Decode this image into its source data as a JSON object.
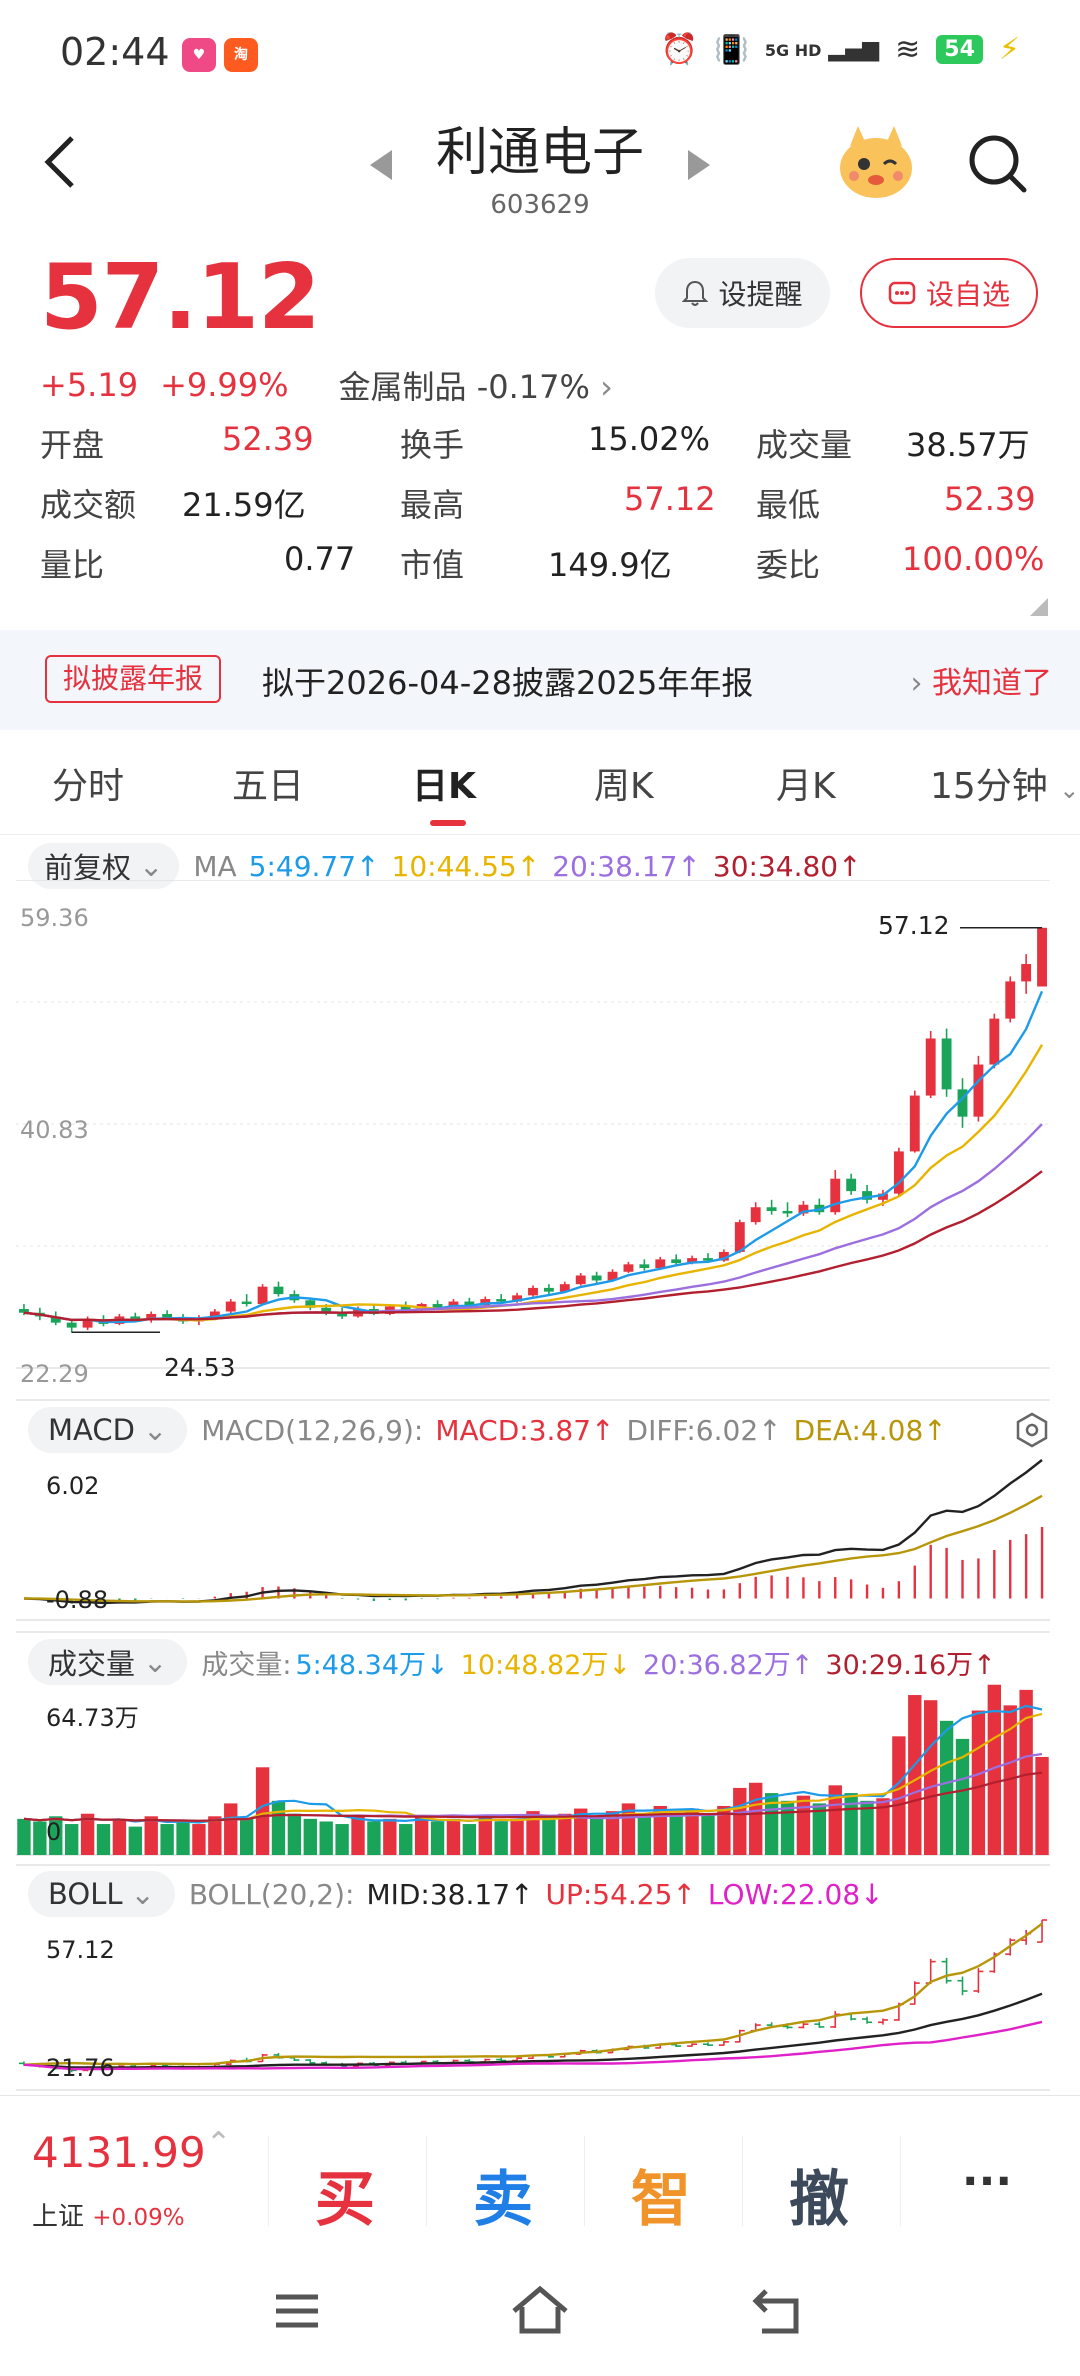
{
  "status_bar": {
    "time": "02:44",
    "network": "5G HD",
    "battery": "54"
  },
  "header": {
    "name": "利通电子",
    "code": "603629"
  },
  "quote": {
    "price": "57.12",
    "change": "+5.19",
    "change_pct": "+9.99%",
    "sector": "金属制品 -0.17%",
    "alert_label": "设提醒",
    "watch_label": "设自选"
  },
  "stats": [
    [
      {
        "label": "开盘",
        "value": "52.39",
        "color": "red"
      },
      {
        "label": "换手",
        "value": "15.02%",
        "color": "dark"
      },
      {
        "label": "成交量",
        "value": "38.57万",
        "color": "dark"
      }
    ],
    [
      {
        "label": "成交额",
        "value": "21.59亿",
        "color": "dark"
      },
      {
        "label": "最高",
        "value": "57.12",
        "color": "red"
      },
      {
        "label": "最低",
        "value": "52.39",
        "color": "red"
      }
    ],
    [
      {
        "label": "量比",
        "value": "0.77",
        "color": "dark"
      },
      {
        "label": "市值",
        "value": "149.9亿",
        "color": "dark"
      },
      {
        "label": "委比",
        "value": "100.00%",
        "color": "red"
      }
    ]
  ],
  "notice": {
    "tag": "拟披露年报",
    "text": "拟于2026-04-28披露2025年年报",
    "action": "我知道了"
  },
  "tabs": [
    "分时",
    "五日",
    "日K",
    "周K",
    "月K",
    "15分钟"
  ],
  "active_tab": 2,
  "ma_row": {
    "select": "前复权",
    "label": "MA",
    "items": [
      {
        "text": "5:49.77↑",
        "color": "#1e9be8"
      },
      {
        "text": "10:44.55↑",
        "color": "#e8b400"
      },
      {
        "text": "20:38.17↑",
        "color": "#9c6fe0"
      },
      {
        "text": "30:34.80↑",
        "color": "#b21f2f"
      }
    ]
  },
  "macd_row": {
    "select": "MACD",
    "label": "MACD(12,26,9):",
    "items": [
      {
        "text": "MACD:3.87↑",
        "color": "#e5323e"
      },
      {
        "text": "DIFF:6.02↑",
        "color": "#666666"
      },
      {
        "text": "DEA:4.08↑",
        "color": "#b8960a"
      }
    ]
  },
  "vol_row": {
    "select": "成交量",
    "label": "成交量:",
    "items": [
      {
        "text": "5:48.34万↓",
        "color": "#1e9be8"
      },
      {
        "text": "10:48.82万↓",
        "color": "#e8b400"
      },
      {
        "text": "20:36.82万↑",
        "color": "#9c6fe0"
      },
      {
        "text": "30:29.16万↑",
        "color": "#b21f2f"
      }
    ]
  },
  "boll_row": {
    "select": "BOLL",
    "label": "BOLL(20,2):",
    "items": [
      {
        "text": "MID:38.17↑",
        "color": "#222222"
      },
      {
        "text": "UP:54.25↑",
        "color": "#e5323e"
      },
      {
        "text": "LOW:22.08↓",
        "color": "#e020c8"
      }
    ]
  },
  "chart_data": {
    "type": "candlestick",
    "price_axis": {
      "top": "59.36",
      "mid": "40.83",
      "bottom": "22.29",
      "ylim": [
        22.29,
        59.36
      ]
    },
    "high_marker": "57.12",
    "low_marker": "24.53",
    "macd_axis": {
      "top": "6.02",
      "bottom": "-0.88",
      "ylim": [
        -0.88,
        6.02
      ]
    },
    "volume_axis": {
      "top": "64.73万",
      "bottom": "0",
      "ylim": [
        0,
        64.73
      ]
    },
    "boll_axis": {
      "top": "57.12",
      "bottom": "21.76",
      "ylim": [
        21.76,
        57.12
      ]
    },
    "colors": {
      "up": "#e5323e",
      "down": "#1aa45a",
      "ma5": "#1e9be8",
      "ma10": "#e8b400",
      "ma20": "#9c6fe0",
      "ma30": "#b21f2f"
    },
    "candles": [
      [
        26.4,
        26.8,
        25.9,
        26.1
      ],
      [
        26.1,
        26.5,
        25.5,
        25.8
      ],
      [
        25.8,
        26.2,
        25.1,
        25.3
      ],
      [
        25.3,
        25.6,
        24.5,
        24.9
      ],
      [
        24.9,
        25.8,
        24.7,
        25.6
      ],
      [
        25.6,
        25.9,
        25.0,
        25.2
      ],
      [
        25.2,
        26.0,
        25.1,
        25.8
      ],
      [
        25.8,
        26.1,
        25.4,
        25.5
      ],
      [
        25.5,
        26.2,
        25.3,
        26.0
      ],
      [
        26.0,
        26.3,
        25.6,
        25.7
      ],
      [
        25.7,
        26.0,
        25.2,
        25.4
      ],
      [
        25.4,
        25.9,
        25.1,
        25.6
      ],
      [
        25.6,
        26.4,
        25.5,
        26.2
      ],
      [
        26.2,
        27.2,
        26.0,
        27.0
      ],
      [
        27.0,
        27.6,
        26.6,
        26.8
      ],
      [
        26.8,
        28.4,
        26.7,
        28.2
      ],
      [
        28.2,
        28.6,
        27.4,
        27.6
      ],
      [
        27.6,
        27.9,
        26.9,
        27.1
      ],
      [
        27.1,
        27.3,
        26.3,
        26.5
      ],
      [
        26.5,
        26.8,
        25.9,
        26.1
      ],
      [
        26.1,
        26.5,
        25.6,
        25.8
      ],
      [
        25.8,
        26.6,
        25.7,
        26.4
      ],
      [
        26.4,
        26.7,
        25.9,
        26.0
      ],
      [
        26.0,
        26.8,
        25.9,
        26.6
      ],
      [
        26.6,
        27.0,
        26.2,
        26.3
      ],
      [
        26.3,
        26.9,
        26.1,
        26.8
      ],
      [
        26.8,
        27.1,
        26.4,
        26.5
      ],
      [
        26.5,
        27.2,
        26.4,
        27.0
      ],
      [
        27.0,
        27.3,
        26.6,
        26.7
      ],
      [
        26.7,
        27.4,
        26.6,
        27.2
      ],
      [
        27.2,
        27.6,
        26.9,
        27.0
      ],
      [
        27.0,
        27.7,
        26.9,
        27.5
      ],
      [
        27.5,
        28.3,
        27.4,
        28.1
      ],
      [
        28.1,
        28.4,
        27.6,
        27.8
      ],
      [
        27.8,
        28.6,
        27.7,
        28.4
      ],
      [
        28.4,
        29.3,
        28.3,
        29.1
      ],
      [
        29.1,
        29.4,
        28.5,
        28.7
      ],
      [
        28.7,
        29.6,
        28.6,
        29.4
      ],
      [
        29.4,
        30.2,
        29.3,
        30.0
      ],
      [
        30.0,
        30.4,
        29.5,
        29.7
      ],
      [
        29.7,
        30.6,
        29.6,
        30.4
      ],
      [
        30.4,
        30.8,
        29.9,
        30.1
      ],
      [
        30.1,
        30.7,
        30.0,
        30.5
      ],
      [
        30.5,
        30.9,
        30.1,
        30.3
      ],
      [
        30.3,
        31.2,
        30.2,
        31.0
      ],
      [
        31.0,
        33.6,
        30.9,
        33.4
      ],
      [
        33.4,
        35.0,
        33.2,
        34.6
      ],
      [
        34.6,
        35.2,
        34.0,
        34.3
      ],
      [
        34.3,
        35.0,
        33.8,
        34.1
      ],
      [
        34.1,
        35.1,
        33.9,
        34.8
      ],
      [
        34.8,
        35.3,
        34.0,
        34.2
      ],
      [
        34.2,
        37.6,
        34.0,
        36.9
      ],
      [
        36.9,
        37.3,
        35.6,
        35.9
      ],
      [
        35.9,
        36.4,
        34.9,
        35.2
      ],
      [
        35.2,
        36.0,
        34.7,
        35.7
      ],
      [
        35.7,
        39.4,
        35.5,
        39.1
      ],
      [
        39.1,
        44.0,
        39.0,
        43.6
      ],
      [
        43.6,
        48.8,
        43.4,
        48.2
      ],
      [
        48.2,
        49.0,
        43.5,
        44.1
      ],
      [
        44.1,
        45.0,
        41.0,
        41.9
      ],
      [
        41.9,
        46.8,
        41.5,
        46.1
      ],
      [
        46.1,
        50.2,
        45.8,
        49.8
      ],
      [
        49.8,
        53.2,
        49.5,
        52.8
      ],
      [
        52.8,
        55.0,
        51.8,
        54.2
      ],
      [
        52.39,
        57.12,
        52.39,
        57.12
      ]
    ],
    "volume": [
      14,
      13,
      15,
      12,
      16,
      12,
      14,
      11,
      15,
      12,
      13,
      12,
      15,
      20,
      14,
      34,
      21,
      16,
      14,
      13,
      12,
      15,
      13,
      14,
      12,
      15,
      13,
      14,
      12,
      15,
      13,
      14,
      17,
      14,
      16,
      18,
      15,
      17,
      20,
      16,
      19,
      16,
      18,
      16,
      19,
      26,
      28,
      24,
      21,
      23,
      20,
      27,
      24,
      21,
      22,
      46,
      62,
      60,
      52,
      45,
      56,
      66,
      58,
      64,
      38
    ]
  },
  "bottom_bar": {
    "index_value": "4131.99",
    "index_name": "上证",
    "index_change": "+0.09%",
    "buy": "买",
    "sell": "卖",
    "smart": "智",
    "cancel": "撤",
    "more": "···"
  }
}
